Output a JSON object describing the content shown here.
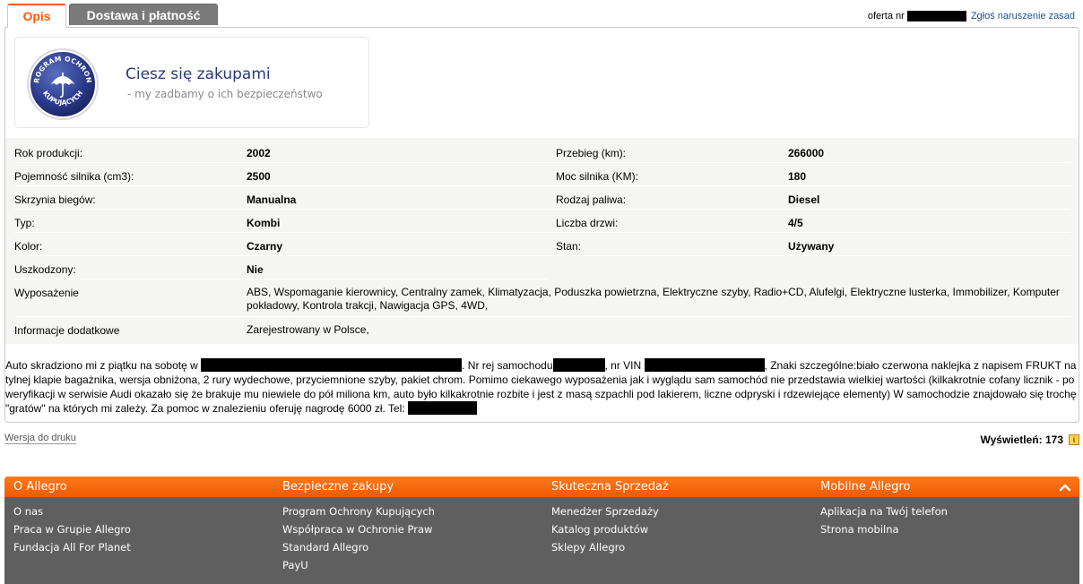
{
  "tabs": [
    {
      "label": "Opis",
      "active": true
    },
    {
      "label": "Dostawa i płatność",
      "active": false
    }
  ],
  "offer": {
    "prefix": "oferta nr",
    "report_link": "Zgłoś naruszenie zasad"
  },
  "protection": {
    "badge_text_top": "PROGRAM OCHRONY",
    "badge_text_bottom": "KUPUJĄCYCH",
    "title": "Ciesz się zakupami",
    "subtitle": "-  my zadbamy o ich bezpieczeństwo"
  },
  "params": [
    {
      "label": "Rok produkcji:",
      "value": "2002"
    },
    {
      "label": "Przebieg (km):",
      "value": "266000"
    },
    {
      "label": "Pojemność silnika (cm3):",
      "value": "2500"
    },
    {
      "label": "Moc silnika (KM):",
      "value": "180"
    },
    {
      "label": "Skrzynia biegów:",
      "value": "Manualna"
    },
    {
      "label": "Rodzaj paliwa:",
      "value": "Diesel"
    },
    {
      "label": "Typ:",
      "value": "Kombi"
    },
    {
      "label": "Liczba drzwi:",
      "value": "4/5"
    },
    {
      "label": "Kolor:",
      "value": "Czarny"
    },
    {
      "label": "Stan:",
      "value": "Używany"
    },
    {
      "label": "Uszkodzony:",
      "value": "Nie"
    }
  ],
  "equipment": {
    "label": "Wyposażenie",
    "value": "ABS, Wspomaganie kierownicy, Centralny zamek, Klimatyzacja, Poduszka powietrzna, Elektryczne szyby, Radio+CD, Alufelgi, Elektryczne lusterka, Immobilizer, Komputer pokładowy, Kontrola trakcji, Nawigacja GPS, 4WD,"
  },
  "additional": {
    "label": "Informacje dodatkowe",
    "value": "Zarejestrowany w Polsce,"
  },
  "description": {
    "part1": "Auto skradziono mi z piątku na sobotę w",
    "part2": ". Nr rej samochodu",
    "part3": ", nr VIN",
    "part4": ", Znaki szczególne:biało czerwona naklejka z napisem FRUKT na tylnej klapie bagażnika, wersja obniżona, 2 rury wydechowe, przyciemnione szyby, pakiet chrom. Pomimo ciekawego wyposażenia jak i wyglądu sam samochód nie przedstawia wielkiej wartości (kilkakrotnie cofany licznik - po weryfikacji w serwisie Audi okazało się że brakuje mu niewiele do pół miliona km, auto było kilkakrotnie rozbite i jest z masą szpachli pod lakierem, liczne odpryski i rdzewiejące elementy) W samochodzie znajdowało się trochę \"gratów\" na których mi zależy. Za pomoc w znalezieniu oferuję nagrodę 6000 zł. Tel:"
  },
  "print_link": "Wersja do druku",
  "views": {
    "label": "Wyświetleń:",
    "count": "173"
  },
  "footer": {
    "columns": [
      {
        "title": "O Allegro",
        "links": [
          "O nas",
          "Praca w Grupie Allegro",
          "Fundacja All For Planet"
        ]
      },
      {
        "title": "Bezpieczne zakupy",
        "links": [
          "Program Ochrony Kupujących",
          "Współpraca w Ochronie Praw",
          "Standard Allegro",
          "PayU"
        ]
      },
      {
        "title": "Skuteczna Sprzedaż",
        "links": [
          "Menedżer Sprzedaży",
          "Katalog produktów",
          "Sklepy Allegro"
        ]
      },
      {
        "title": "Mobilne Allegro",
        "links": [
          "Aplikacja na Twój telefon",
          "Strona mobilna"
        ]
      }
    ]
  },
  "colors": {
    "accent": "#ff5a00",
    "footer_bg": "#5f5f5f",
    "link": "#1a5499",
    "badge_blue": "#2a3a78"
  }
}
